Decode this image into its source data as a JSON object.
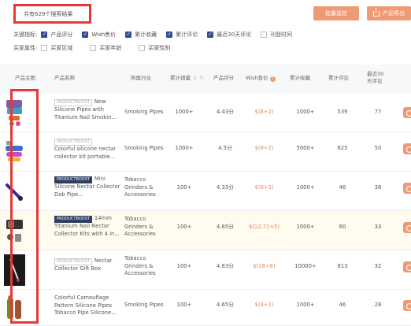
{
  "toolbar": {
    "result_text": "共有629个搜索结果",
    "monitor_label": "批量监控",
    "export_label": "产品导出"
  },
  "filters": {
    "keyword_label": "关键指标:",
    "keyword_options": [
      {
        "label": "产品评分",
        "checked": true
      },
      {
        "label": "Wish售价",
        "checked": true
      },
      {
        "label": "累计收藏",
        "checked": true
      },
      {
        "label": "累计评论",
        "checked": true
      },
      {
        "label": "最近30天评论",
        "checked": true
      },
      {
        "label": "刊登时间",
        "checked": false
      }
    ],
    "buyer_label": "买家属性:",
    "buyer_options": [
      {
        "label": "买家区域",
        "checked": false
      },
      {
        "label": "买家年龄",
        "checked": false
      },
      {
        "label": "买家性别",
        "checked": false
      }
    ]
  },
  "table": {
    "headers": {
      "image": "产品主图",
      "name": "产品名称",
      "industry": "所属行业",
      "sales": "累计销量",
      "rating": "产品评分",
      "wish": "Wish售价",
      "fav": "累计收藏",
      "reviews": "累计评论",
      "recent1": "最近30",
      "recent2": "天评论"
    },
    "rows": [
      {
        "badge": "PRODUCTBOOST",
        "badge_dark": false,
        "name": "New Silicone Pipes with Titanium Nail Smokin...",
        "industry": "Smoking Pipes",
        "sales": "1000+",
        "rating": "4.43分",
        "wish": "$(8+2)",
        "fav": "1000+",
        "reviews": "539",
        "recent": "77",
        "highlight": false
      },
      {
        "badge": "PRODUCTBOOST",
        "badge_dark": false,
        "name": "Colorful silicone nectar collector kit portable...",
        "industry": "Smoking Pipes",
        "sales": "1000+",
        "rating": "4.5分",
        "wish": "$(8+2)",
        "fav": "5000+",
        "reviews": "625",
        "recent": "50",
        "highlight": false
      },
      {
        "badge": "PRODUCTBOOST",
        "badge_dark": true,
        "name": "Mini Silicone Nectar Collector Dab Pipe...",
        "industry": "Tobacco Grinders & Accessories",
        "sales": "100+",
        "rating": "4.33分",
        "wish": "$(8+3)",
        "fav": "1000+",
        "reviews": "46",
        "recent": "38",
        "highlight": false
      },
      {
        "badge": "PRODUCTBOOST",
        "badge_dark": true,
        "name": "14mm Titanium Nail Nectar Collector Kits with 4 in...",
        "industry": "Tobacco Grinders & Accessories",
        "sales": "100+",
        "rating": "4.65分",
        "wish": "$(12.71+5)",
        "fav": "1000+",
        "reviews": "60",
        "recent": "33",
        "highlight": true
      },
      {
        "badge": "PRODUCTBOOST",
        "badge_dark": false,
        "name": "Nectar Collector Gift Box",
        "industry": "Tobacco Grinders & Accessories",
        "sales": "100+",
        "rating": "4.63分",
        "wish": "$(18+6)",
        "fav": "10000+",
        "reviews": "813",
        "recent": "32",
        "highlight": false
      },
      {
        "badge": "",
        "badge_dark": false,
        "name": "Colorful Camouflage Pattern Silicone Pipes Tobacco Pipe Silicone...",
        "industry": "Smoking Pipes",
        "sales": "100+",
        "rating": "4.65分",
        "wish": "$(8+2)",
        "fav": "1000+",
        "reviews": "46",
        "recent": "28",
        "highlight": false
      }
    ]
  }
}
